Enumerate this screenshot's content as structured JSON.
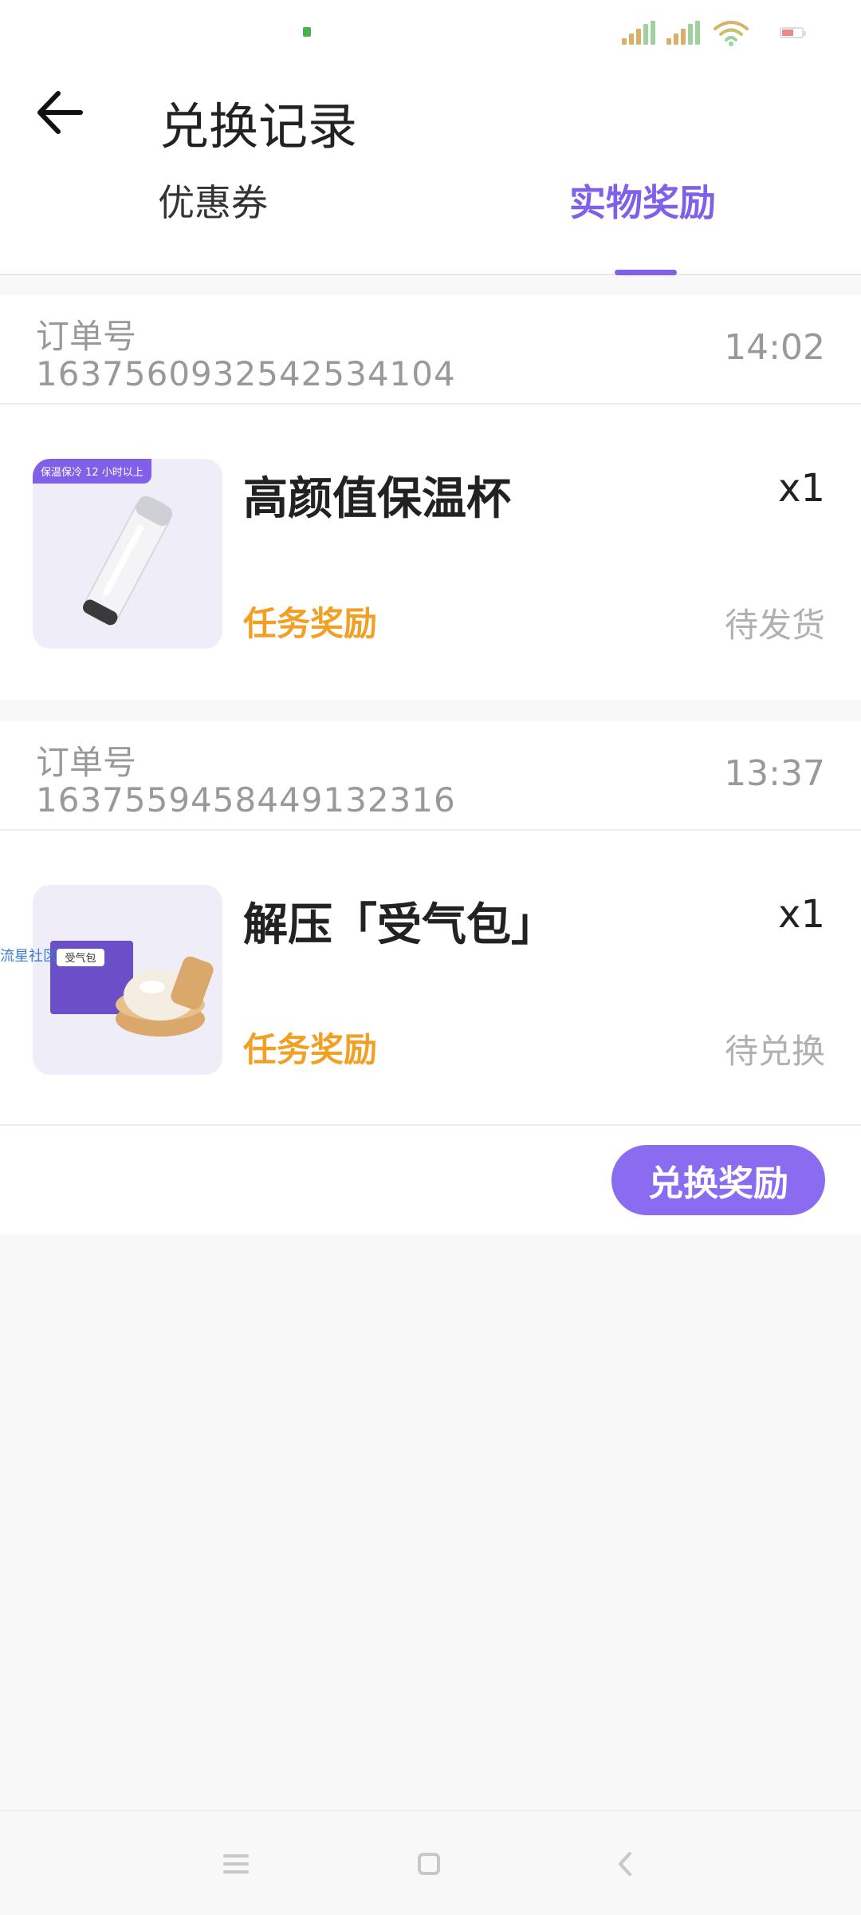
{
  "status_bar": {
    "icons": [
      "sim-signal-icon",
      "sim-signal-icon",
      "wifi-icon",
      "battery-icon"
    ]
  },
  "header": {
    "title": "兑换记录",
    "back_icon": "arrow-left-icon",
    "tabs": [
      {
        "label": "优惠券",
        "active": false
      },
      {
        "label": "实物奖励",
        "active": true
      }
    ],
    "accent_color": "#8060e8"
  },
  "orders": [
    {
      "order_label": "订单号",
      "order_no": "1637560932542534104",
      "time": "14:02",
      "thumb_tag": "保温保冷 12 小时以上",
      "item_name": "高颜值保温杯",
      "quantity": "x1",
      "source": "任务奖励",
      "status": "待发货"
    },
    {
      "order_label": "订单号",
      "order_no": "1637559458449132316",
      "time": "13:37",
      "item_name": "解压「受气包」",
      "quantity": "x1",
      "source": "任务奖励",
      "status": "待兑换",
      "action_label": "兑换奖励",
      "watermark": "流星社区",
      "box_text": "受气包"
    }
  ],
  "colors": {
    "source_color": "#f2a024",
    "status_color": "#b0b0b0",
    "button_color": "#8a6cf0"
  },
  "nav_bar": {
    "icons": [
      "menu-icon",
      "home-square-icon",
      "back-chevron-icon"
    ]
  }
}
